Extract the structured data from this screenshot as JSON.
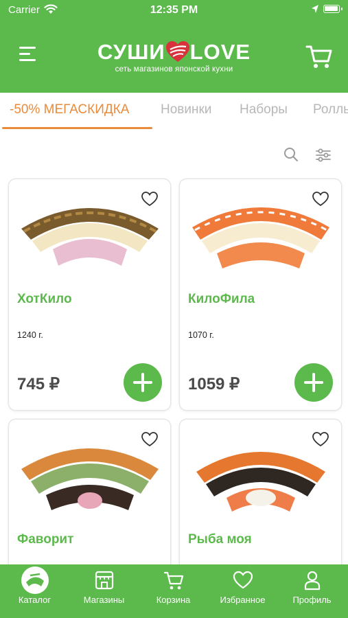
{
  "status": {
    "carrier": "Carrier",
    "time": "12:35 PM"
  },
  "header": {
    "brand_left": "СУШИ",
    "brand_right": "LOVE",
    "tagline": "сеть магазинов японской кухни",
    "brand_color": "#5cb94c"
  },
  "tabs": [
    {
      "label": "-50% МЕГАСКИДКА",
      "active": true
    },
    {
      "label": "Новинки",
      "active": false
    },
    {
      "label": "Наборы",
      "active": false
    },
    {
      "label": "Роллы",
      "active": false
    }
  ],
  "accent_color": "#e98b3a",
  "products": [
    {
      "name": "ХотКило",
      "weight": "1240 г.",
      "price": "745 ₽"
    },
    {
      "name": "КилоФила",
      "weight": "1070 г.",
      "price": "1059 ₽"
    },
    {
      "name": "Фаворит",
      "weight": "",
      "price": ""
    },
    {
      "name": "Рыба моя",
      "weight": "",
      "price": ""
    }
  ],
  "bottom_nav": [
    {
      "label": "Каталог",
      "icon": "catalog-icon",
      "active": true
    },
    {
      "label": "Магазины",
      "icon": "store-icon",
      "active": false
    },
    {
      "label": "Корзина",
      "icon": "cart-icon",
      "active": false
    },
    {
      "label": "Избранное",
      "icon": "heart-icon",
      "active": false
    },
    {
      "label": "Профиль",
      "icon": "user-icon",
      "active": false
    }
  ]
}
